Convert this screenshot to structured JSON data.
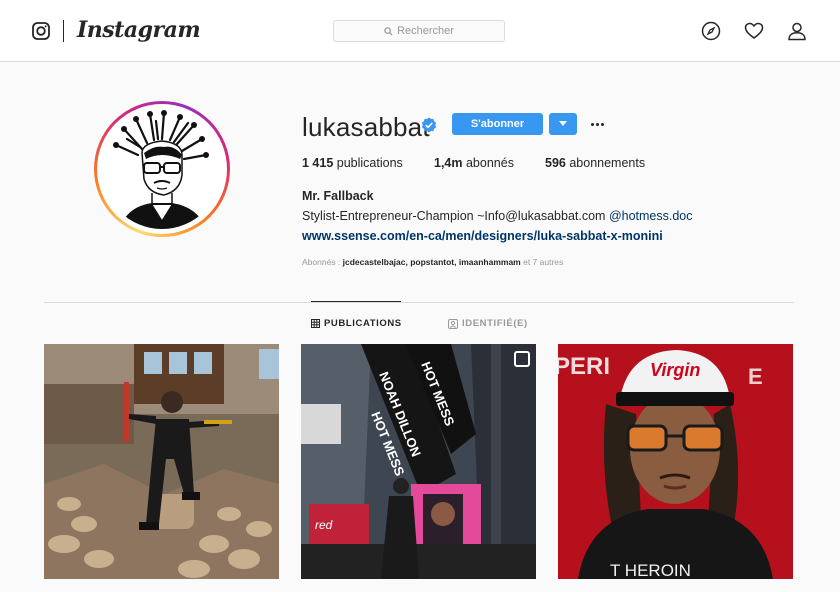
{
  "nav": {
    "brand": "Instagram",
    "search_placeholder": "Rechercher"
  },
  "profile": {
    "username": "lukasabbat",
    "follow_label": "S'abonner",
    "stats": [
      {
        "count": "1 415",
        "label": "publications"
      },
      {
        "count": "1,4m",
        "label": "abonnés"
      },
      {
        "count": "596",
        "label": "abonnements"
      }
    ],
    "full_name": "Mr. Fallback",
    "bio_text": "Stylist-Entrepreneur-Champion ~Info@lukasabbat.com ",
    "bio_mention": "@hotmess.doc",
    "website": "www.ssense.com/en-ca/men/designers/luka-sabbat-x-monini",
    "followed_by": {
      "prefix": "Abonnés : ",
      "names": "jcdecastelbajac, popstantot, imaanhammam",
      "suffix": " et 7 autres"
    }
  },
  "tabs": [
    {
      "label": "PUBLICATIONS",
      "active": true
    },
    {
      "label": "IDENTIFIÉ(E)",
      "active": false
    }
  ],
  "posts": [
    {
      "alt": "woodpile"
    },
    {
      "alt": "times square"
    },
    {
      "alt": "portrait"
    }
  ],
  "colors": {
    "accent": "#3897f0",
    "link": "#003569",
    "muted": "#999999"
  }
}
